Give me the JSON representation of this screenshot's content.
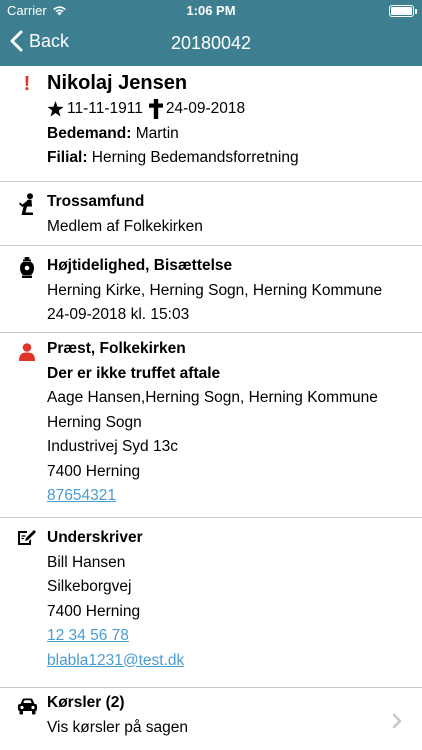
{
  "status": {
    "carrier": "Carrier",
    "time": "1:06 PM",
    "battery_level": 1.0
  },
  "navbar": {
    "back_label": "Back",
    "title": "20180042"
  },
  "deceased": {
    "alert_mark": "!",
    "name": "Nikolaj Jensen",
    "born": "11-11-1911",
    "died": "24-09-2018",
    "undertaker_label": "Bedemand:",
    "undertaker": "Martin",
    "branch_label": "Filial:",
    "branch": "Herning Bedemandsforretning"
  },
  "religion": {
    "title": "Trossamfund",
    "value": "Medlem af Folkekirken"
  },
  "ceremony": {
    "title": "Højtidelighed, Bisættelse",
    "place": "Herning Kirke, Herning Sogn, Herning Kommune",
    "datetime": "24-09-2018 kl. 15:03"
  },
  "priest": {
    "title": "Præst, Folkekirken",
    "status": "Der er ikke truffet aftale",
    "name_line": "Aage Hansen,Herning Sogn, Herning Kommune",
    "parish": "Herning Sogn",
    "street": "Industrivej Syd 13c",
    "city": "7400  Herning",
    "phone": "87654321"
  },
  "signer": {
    "title": "Underskriver",
    "name": "Bill Hansen",
    "street": "Silkeborgvej",
    "city": "7400 Herning",
    "phone": "12 34 56 78",
    "email": "blabla1231@test.dk"
  },
  "drives": {
    "title": "Kørsler (2)",
    "subtitle": "Vis kørsler på sagen"
  },
  "colors": {
    "header": "#3d7f90",
    "alert": "#e0352b",
    "priest_icon": "#e0352b",
    "link": "#4a9bd0",
    "chevron": "#c7c7cc"
  },
  "icons": {
    "alert": "exclamation-icon",
    "star": "star-icon",
    "cross": "cross-icon",
    "religion": "kneeling-person-icon",
    "ceremony": "urn-icon",
    "priest": "person-icon",
    "signer": "signature-icon",
    "drives": "car-icon",
    "chevron": "chevron-right-icon"
  }
}
